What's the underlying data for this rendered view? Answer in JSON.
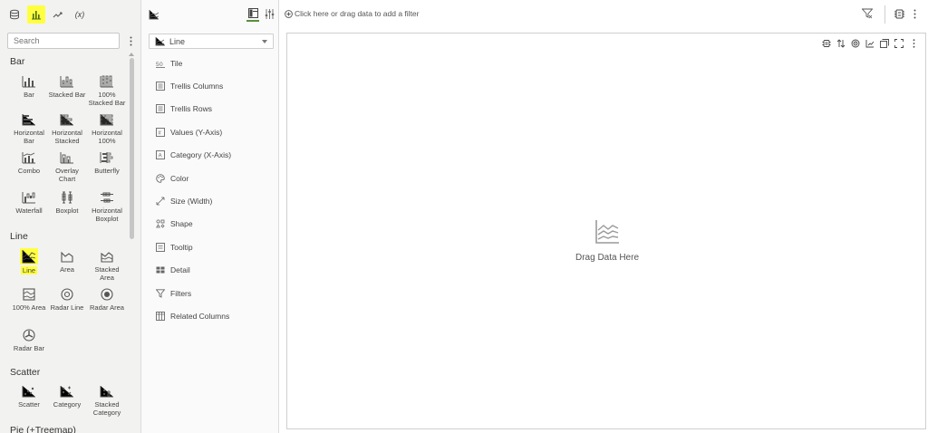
{
  "left_panel": {
    "tabs": [
      {
        "name": "data-icon"
      },
      {
        "name": "visualizations-icon",
        "active": true,
        "highlight_color": "#ffff40"
      },
      {
        "name": "analytics-icon"
      },
      {
        "name": "calculations-tab",
        "text": "(x)"
      }
    ],
    "search": {
      "placeholder": "Search"
    },
    "sections": {
      "bar": {
        "title": "Bar",
        "items": [
          {
            "label": "Bar",
            "icon": "bar-chart-icon"
          },
          {
            "label": "Stacked Bar",
            "icon": "stacked-bar-icon"
          },
          {
            "label": "100%\nStacked Bar",
            "icon": "percent-stacked-bar-icon"
          },
          {
            "label": "Horizontal\nBar",
            "icon": "horizontal-bar-icon"
          },
          {
            "label": "Horizontal\nStacked",
            "icon": "horizontal-stacked-icon"
          },
          {
            "label": "Horizontal\n100%",
            "icon": "horizontal-100-icon"
          },
          {
            "label": "Combo",
            "icon": "combo-chart-icon"
          },
          {
            "label": "Overlay\nChart",
            "icon": "overlay-chart-icon"
          },
          {
            "label": "Butterfly",
            "icon": "butterfly-chart-icon"
          },
          {
            "label": "Waterfall",
            "icon": "waterfall-chart-icon"
          },
          {
            "label": "Boxplot",
            "icon": "boxplot-icon"
          },
          {
            "label": "Horizontal\nBoxplot",
            "icon": "horizontal-boxplot-icon"
          }
        ]
      },
      "line": {
        "title": "Line",
        "items": [
          {
            "label": "Line",
            "icon": "line-chart-icon",
            "highlighted": true
          },
          {
            "label": "Area",
            "icon": "area-chart-icon"
          },
          {
            "label": "Stacked\nArea",
            "icon": "stacked-area-icon"
          },
          {
            "label": "100% Area",
            "icon": "percent-area-icon"
          },
          {
            "label": "Radar Line",
            "icon": "radar-line-icon"
          },
          {
            "label": "Radar Area",
            "icon": "radar-area-icon"
          },
          {
            "label": "Radar Bar",
            "icon": "radar-bar-icon"
          }
        ]
      },
      "scatter": {
        "title": "Scatter",
        "items": [
          {
            "label": "Scatter",
            "icon": "scatter-icon"
          },
          {
            "label": "Category",
            "icon": "category-scatter-icon"
          },
          {
            "label": "Stacked\nCategory",
            "icon": "stacked-category-icon"
          }
        ]
      },
      "pie": {
        "title": "Pie (+Treemap)"
      }
    }
  },
  "middle_panel": {
    "viz_type": "Line",
    "grammar": [
      {
        "label": "Tile",
        "icon": "tile-icon"
      },
      {
        "label": "Trellis Columns",
        "icon": "trellis-columns-icon"
      },
      {
        "label": "Trellis Rows",
        "icon": "trellis-rows-icon"
      },
      {
        "label": "Values (Y-Axis)",
        "icon": "values-axis-icon"
      },
      {
        "label": "Category (X-Axis)",
        "icon": "category-axis-icon"
      },
      {
        "label": "Color",
        "icon": "color-palette-icon"
      },
      {
        "label": "Size (Width)",
        "icon": "size-icon"
      },
      {
        "label": "Shape",
        "icon": "shape-icon"
      },
      {
        "label": "Tooltip",
        "icon": "tooltip-icon"
      },
      {
        "label": "Detail",
        "icon": "detail-icon"
      },
      {
        "label": "Filters",
        "icon": "filter-icon"
      },
      {
        "label": "Related Columns",
        "icon": "related-columns-icon"
      }
    ]
  },
  "filter_bar": {
    "placeholder": "Click here or drag data to add a filter"
  },
  "canvas": {
    "drop_text": "Drag Data Here"
  },
  "colors": {
    "highlight": "#ffff40",
    "active_underline": "#5a8f3c",
    "panel_bg": "#f2f2f1"
  }
}
